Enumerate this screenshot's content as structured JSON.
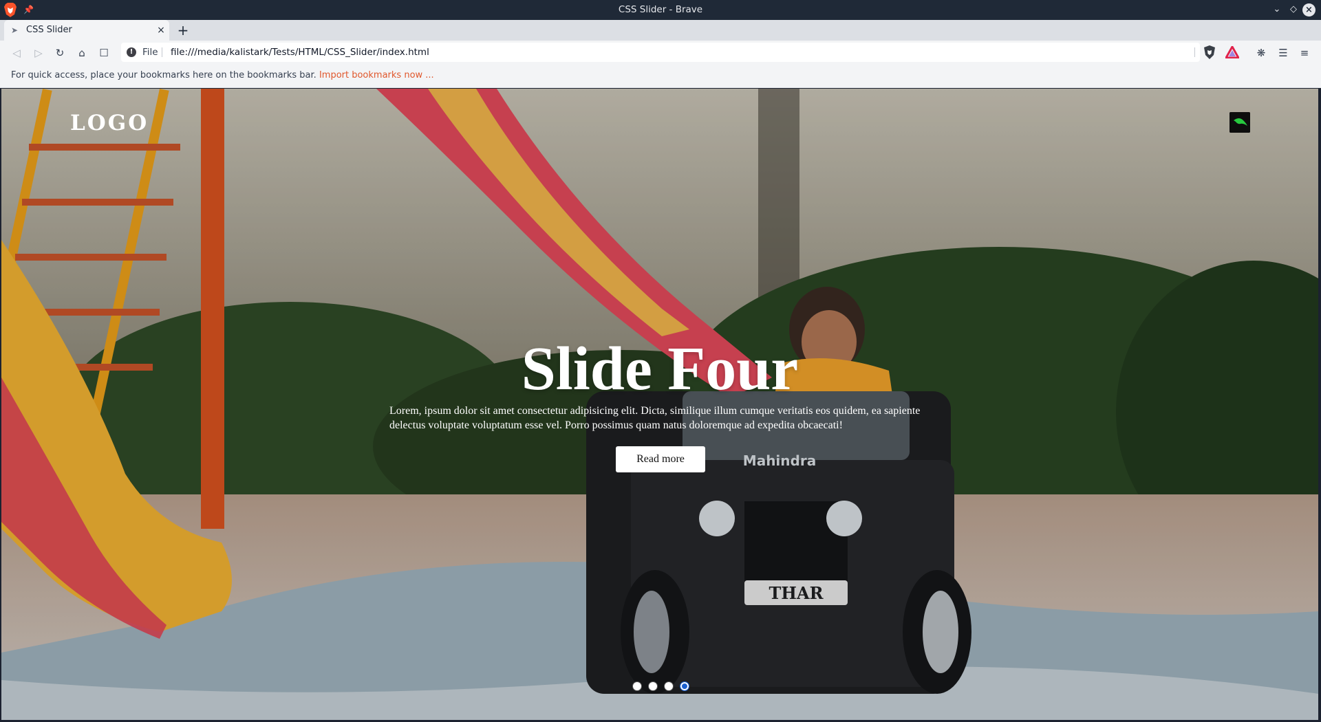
{
  "window": {
    "title": "CSS Slider - Brave",
    "controls": [
      "minimize",
      "maximize",
      "close"
    ]
  },
  "tabs": [
    {
      "label": "CSS Slider",
      "active": true
    }
  ],
  "toolbar": {
    "scheme_label": "File",
    "url": "file:///media/kalistark/Tests/HTML/CSS_Slider/index.html",
    "icons": [
      "back-icon",
      "forward-icon",
      "reload-icon",
      "home-icon",
      "bookmark-icon",
      "brave-shields-icon",
      "brave-rewards-icon",
      "extensions-icon",
      "media-icon",
      "menu-icon"
    ]
  },
  "bookmarks_bar": {
    "message": "For quick access, place your bookmarks here on the bookmarks bar.",
    "link": "Import bookmarks now ..."
  },
  "page": {
    "logo": "LOGO",
    "slide": {
      "title": "Slide Four",
      "text": "Lorem, ipsum dolor sit amet consectetur adipisicing elit. Dicta, similique illum cumque veritatis eos quidem, ea sapiente delectus voluptate voluptatum esse vel. Porro possimus quam natus doloremque ad expedita obcaecati!",
      "button_label": "Read more",
      "vehicle_brand": "Mahindra",
      "vehicle_model": "THAR"
    },
    "dots": {
      "count": 4,
      "active_index": 3
    }
  },
  "colors": {
    "titlebar": "#1f2937",
    "link": "#e0572c",
    "active_dot": "#1a5fd0"
  }
}
